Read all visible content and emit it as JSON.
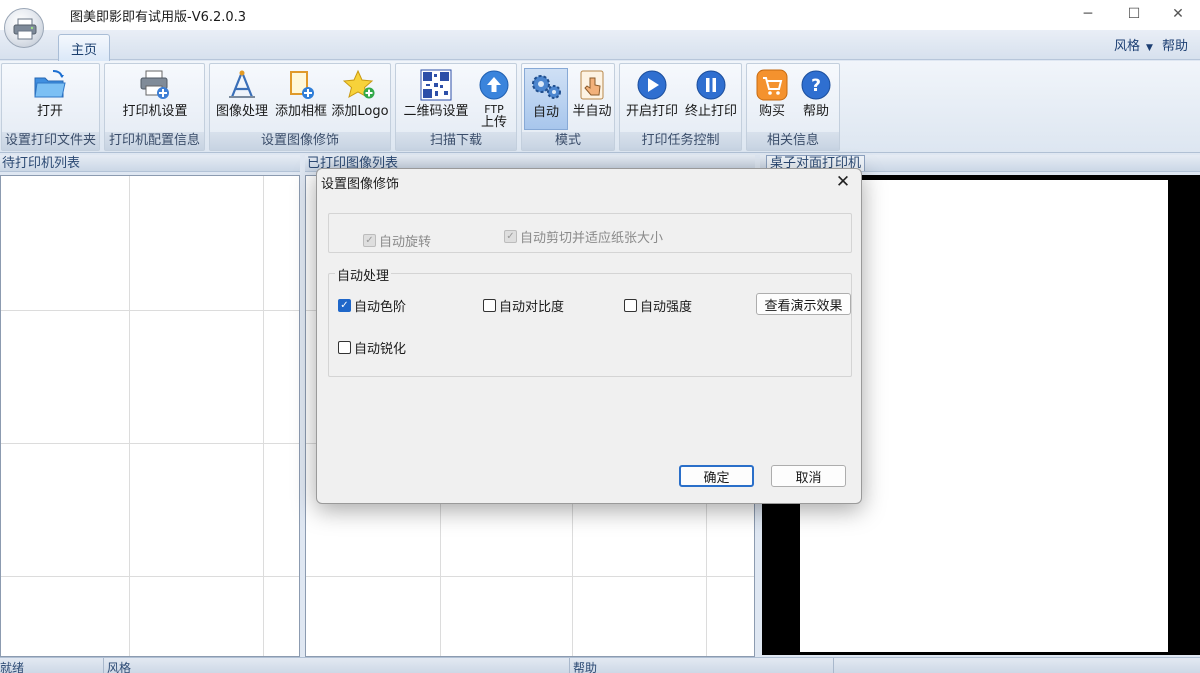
{
  "window": {
    "title": "图美即影即有试用版-V6.2.0.3"
  },
  "tabs": {
    "home": "主页"
  },
  "top_menu": {
    "style": "风格",
    "help": "帮助"
  },
  "ribbon": {
    "groups": [
      {
        "label": "设置打印文件夹",
        "buttons": [
          {
            "label": "打开",
            "icon": "folder-open-icon"
          }
        ]
      },
      {
        "label": "打印机配置信息",
        "buttons": [
          {
            "label": "打印机设置",
            "icon": "printer-settings-icon"
          }
        ]
      },
      {
        "label": "设置图像修饰",
        "buttons": [
          {
            "label": "图像处理",
            "icon": "image-process-icon"
          },
          {
            "label": "添加相框",
            "icon": "add-frame-icon"
          },
          {
            "label": "添加Logo",
            "icon": "add-logo-star-icon"
          }
        ]
      },
      {
        "label": "扫描下载",
        "buttons": [
          {
            "label": "二维码设置",
            "icon": "qrcode-icon"
          },
          {
            "label": "FTP",
            "label2": "上传",
            "icon": "upload-arrow-icon"
          }
        ]
      },
      {
        "label": "模式",
        "buttons": [
          {
            "label": "自动",
            "icon": "gears-icon",
            "active": true
          },
          {
            "label": "半自动",
            "icon": "hand-pointer-icon"
          }
        ]
      },
      {
        "label": "打印任务控制",
        "buttons": [
          {
            "label": "开启打印",
            "icon": "play-icon"
          },
          {
            "label": "终止打印",
            "icon": "pause-icon"
          }
        ]
      },
      {
        "label": "相关信息",
        "buttons": [
          {
            "label": "购买",
            "icon": "shopping-cart-icon"
          },
          {
            "label": "帮助",
            "icon": "help-question-icon"
          }
        ]
      }
    ]
  },
  "panels": {
    "left": "待打印机列表",
    "middle": "已打印图像列表",
    "right": "桌子对面打印机"
  },
  "statusbar": {
    "ready": "就绪",
    "style": "风格",
    "help": "帮助"
  },
  "dialog": {
    "title": "设置图像修饰",
    "top_group": {
      "auto_rotate": {
        "label": "自动旋转",
        "checked": true,
        "disabled": true
      },
      "auto_crop": {
        "label": "自动剪切并适应纸张大小",
        "checked": true,
        "disabled": true
      }
    },
    "auto_group": {
      "legend": "自动处理",
      "auto_levels": {
        "label": "自动色阶",
        "checked": true
      },
      "auto_contrast": {
        "label": "自动对比度",
        "checked": false
      },
      "auto_strength": {
        "label": "自动强度",
        "checked": false
      },
      "auto_sharpen": {
        "label": "自动锐化",
        "checked": false
      },
      "preview_button": "查看演示效果"
    },
    "ok_button": "确定",
    "cancel_button": "取消"
  }
}
